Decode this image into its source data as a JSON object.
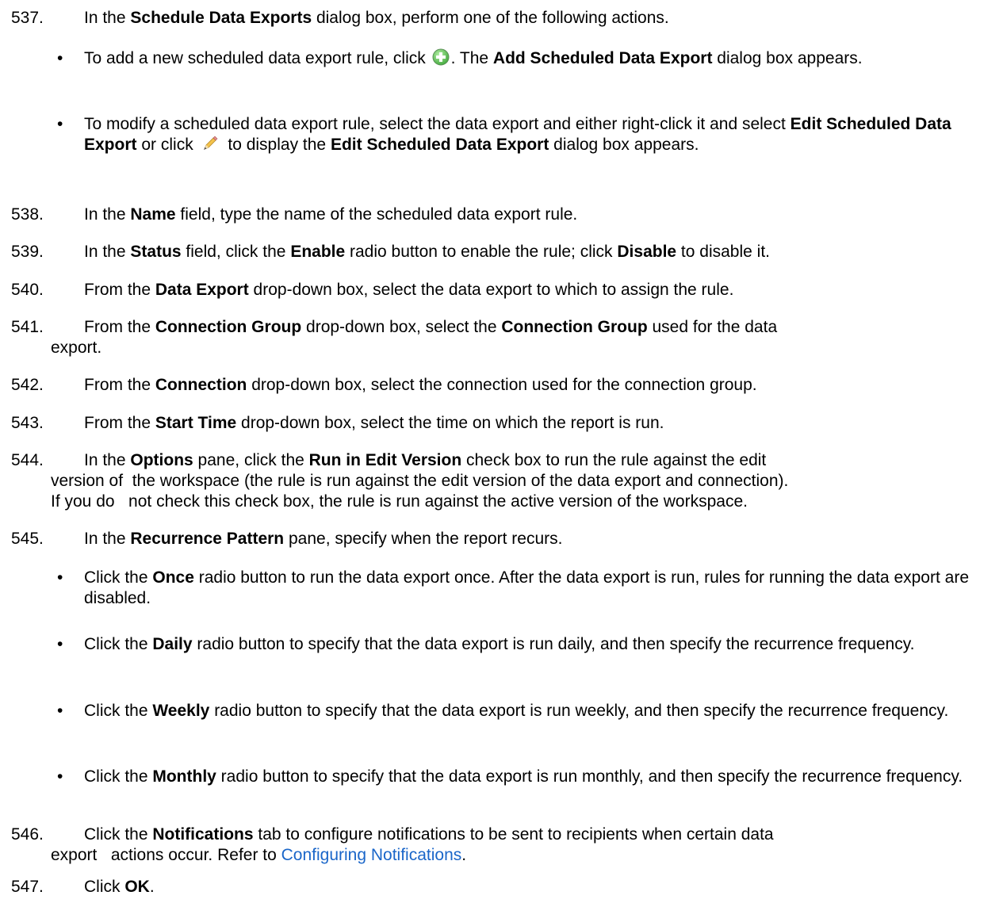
{
  "steps": {
    "s537": {
      "num": "537.",
      "t1": "In the ",
      "b1": "Schedule Data Exports",
      "t2": " dialog box, perform one of the following actions."
    },
    "bullet_add": {
      "t1": "To add a new scheduled data export rule, click ",
      "t2": ". The ",
      "b1": "Add Scheduled Data Export",
      "t3": " dialog box appears."
    },
    "bullet_modify": {
      "t1": "To modify a scheduled data export rule, select the data export and either right-click it and select ",
      "b1": "Edit Scheduled Data Export",
      "t2": " or click ",
      "t3": " to display the ",
      "b2": "Edit Scheduled Data Export",
      "t4": " dialog box appears."
    },
    "s538": {
      "num": "538.",
      "t1": "In the ",
      "b1": "Name",
      "t2": " field, type the name of the scheduled data export rule."
    },
    "s539": {
      "num": "539.",
      "t1": "In the ",
      "b1": "Status",
      "t2": " field, click the ",
      "b2": "Enable",
      "t3": " radio button to enable the rule; click ",
      "b3": "Disable",
      "t4": " to disable it."
    },
    "s540": {
      "num": "540.",
      "t1": "From the ",
      "b1": "Data Export",
      "t2": " drop-down box, select the data export to which to assign the rule."
    },
    "s541": {
      "num": "541.",
      "t1": "From the ",
      "b1": "Connection Group",
      "t2": " drop-down box, select the ",
      "b2": "Connection Group",
      "t3": " used for the data",
      "t4": "export."
    },
    "s542": {
      "num": "542.",
      "t1": "From the ",
      "b1": "Connection",
      "t2": " drop-down box, select the connection used for the connection group."
    },
    "s543": {
      "num": "543.",
      "t1": "From the ",
      "b1": "Start Time",
      "t2": " drop-down box, select the time on which the report is run."
    },
    "s544": {
      "num": "544.",
      "t1": "In the ",
      "b1": "Options",
      "t2": " pane, click the ",
      "b2": "Run in Edit Version",
      "t3": " check box to run the rule against the edit",
      "t4": "version of  the workspace (the rule is run against the edit version of the data export and connection).",
      "t5": "If you do   not check this check box, the rule is run against the active version of the workspace."
    },
    "s545": {
      "num": "545.",
      "t1": "In the ",
      "b1": "Recurrence Pattern",
      "t2": " pane, specify when the report recurs."
    },
    "bullet_once": {
      "t1": "Click the ",
      "b1": "Once",
      "t2": " radio button to run the data export once. After the data export is run, rules for running the data export are disabled."
    },
    "bullet_daily": {
      "t1": "Click the ",
      "b1": "Daily",
      "t2": " radio button to specify that the data export is run daily, and then specify the recurrence frequency."
    },
    "bullet_weekly": {
      "t1": "Click the ",
      "b1": "Weekly",
      "t2": " radio button to specify that the data export is run weekly, and then specify the recurrence frequency."
    },
    "bullet_monthly": {
      "t1": "Click the ",
      "b1": "Monthly",
      "t2": " radio button to specify that the data export is run monthly, and then specify the recurrence frequency."
    },
    "s546": {
      "num": "546.",
      "t1": "Click the ",
      "b1": "Notifications",
      "t2": " tab to configure notifications to be sent to recipients when certain data",
      "t3": "export   actions occur. Refer to ",
      "link": "Configuring Notifications",
      "t4": "."
    },
    "s547": {
      "num": "547.",
      "t1": "Click ",
      "b1": "OK",
      "t2": "."
    }
  },
  "bullet_char": "•",
  "icons": {
    "add": "add-circle-icon",
    "edit": "pencil-icon"
  },
  "colors": {
    "link": "#1a66c9",
    "add_icon": "#5cb85c"
  }
}
